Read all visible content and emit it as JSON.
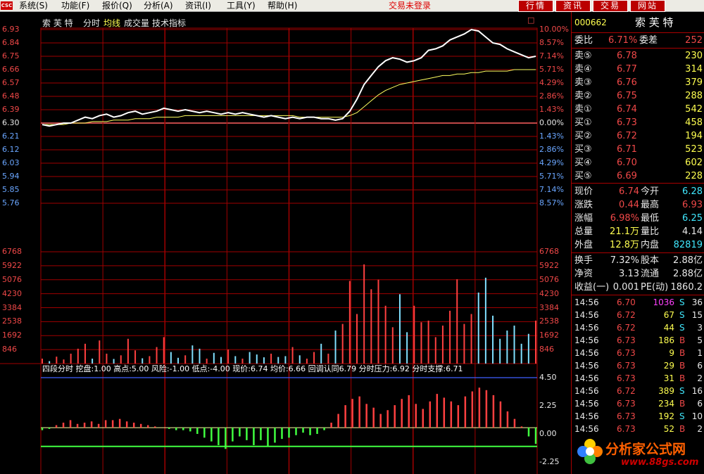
{
  "menubar": {
    "logo": "CSC",
    "menus": [
      "系统(S)",
      "功能(F)",
      "报价(Q)",
      "分析(A)",
      "资讯(I)",
      "工具(Y)",
      "帮助(H)"
    ],
    "login_status": "交易未登录",
    "buttons": [
      "行情",
      "资讯",
      "交易",
      "网站"
    ]
  },
  "chart": {
    "stock_name": "索 芙 特",
    "tabs": [
      "分时",
      "均线",
      "成交量",
      "技术指标"
    ],
    "price_ticks": [
      "6.93",
      "6.84",
      "6.75",
      "6.66",
      "6.57",
      "6.48",
      "6.39",
      "6.30",
      "6.21",
      "6.12",
      "6.03",
      "5.94",
      "5.85",
      "5.76"
    ],
    "pct_ticks": [
      "10.00%",
      "8.57%",
      "7.14%",
      "5.71%",
      "4.29%",
      "2.86%",
      "1.43%",
      "0.00%",
      "1.43%",
      "2.86%",
      "4.29%",
      "5.71%",
      "7.14%",
      "8.57%"
    ],
    "volume_ticks": [
      "6768",
      "5922",
      "5076",
      "4230",
      "3384",
      "2538",
      "1692",
      "846"
    ],
    "indicator_header": [
      "四段分时",
      "挖盘:1.00",
      "高点:5.00",
      "风险:-1.00",
      "低点:-4.00",
      "现价:6.74",
      "均价:6.66",
      "回调认同6.79",
      "分时压力:6.92",
      "分时支撑:6.71"
    ],
    "indicator_ticks": [
      "4.50",
      "2.25",
      "0.00",
      "-2.25"
    ],
    "corner_box": "□",
    "colors": {
      "up": "#f04848",
      "down": "#40ff40",
      "price_line": "#ffffff",
      "avg_line": "#ffff60",
      "grid": "#a00000",
      "axis_blue": "#6aa6ff"
    }
  },
  "chart_data": {
    "type": "line",
    "x_label": "",
    "price_series": [
      6.29,
      6.28,
      6.29,
      6.3,
      6.3,
      6.32,
      6.34,
      6.33,
      6.35,
      6.36,
      6.34,
      6.35,
      6.37,
      6.38,
      6.36,
      6.37,
      6.38,
      6.4,
      6.39,
      6.38,
      6.39,
      6.38,
      6.37,
      6.38,
      6.37,
      6.36,
      6.37,
      6.36,
      6.37,
      6.36,
      6.35,
      6.34,
      6.35,
      6.34,
      6.33,
      6.34,
      6.33,
      6.34,
      6.34,
      6.33,
      6.33,
      6.32,
      6.33,
      6.38,
      6.46,
      6.56,
      6.62,
      6.68,
      6.72,
      6.74,
      6.73,
      6.71,
      6.72,
      6.74,
      6.79,
      6.8,
      6.82,
      6.86,
      6.88,
      6.9,
      6.93,
      6.92,
      6.88,
      6.84,
      6.83,
      6.8,
      6.78,
      6.76,
      6.74,
      6.75
    ],
    "avg_series": [
      6.29,
      6.29,
      6.29,
      6.29,
      6.3,
      6.3,
      6.3,
      6.31,
      6.31,
      6.31,
      6.32,
      6.32,
      6.32,
      6.33,
      6.33,
      6.33,
      6.34,
      6.34,
      6.34,
      6.34,
      6.35,
      6.35,
      6.35,
      6.35,
      6.35,
      6.35,
      6.35,
      6.35,
      6.35,
      6.35,
      6.35,
      6.35,
      6.35,
      6.35,
      6.35,
      6.35,
      6.34,
      6.34,
      6.34,
      6.34,
      6.34,
      6.34,
      6.34,
      6.35,
      6.37,
      6.41,
      6.45,
      6.49,
      6.52,
      6.54,
      6.56,
      6.57,
      6.58,
      6.59,
      6.6,
      6.61,
      6.62,
      6.62,
      6.63,
      6.63,
      6.64,
      6.64,
      6.65,
      6.65,
      6.65,
      6.65,
      6.66,
      6.66,
      6.66,
      6.66
    ],
    "volume_series": [
      300,
      150,
      420,
      250,
      600,
      900,
      1200,
      300,
      1400,
      600,
      280,
      500,
      1500,
      800,
      320,
      450,
      1000,
      1600,
      700,
      350,
      500,
      1100,
      900,
      300,
      650,
      400,
      850,
      450,
      300,
      700,
      550,
      380,
      600,
      400,
      450,
      1000,
      500,
      300,
      700,
      1200,
      600,
      2000,
      2400,
      5000,
      3000,
      6000,
      4500,
      5076,
      3500,
      2200,
      4200,
      1900,
      3500,
      2500,
      2600,
      1600,
      2300,
      3200,
      5100,
      2400,
      3000,
      4300,
      5200,
      2900,
      1500,
      2000,
      2300,
      1200,
      1800,
      2600
    ],
    "indicator_series": [
      0.3,
      0.4,
      0.7,
      0.9,
      1.1,
      0.8,
      0.9,
      1.0,
      0.8,
      1.1,
      1.1,
      1.2,
      1.0,
      0.9,
      0.8,
      0.7,
      0.6,
      0.5,
      0.4,
      0.3,
      0.3,
      0.2,
      0.0,
      -0.3,
      -0.6,
      -0.9,
      -1.2,
      -0.6,
      -0.2,
      -0.5,
      -0.9,
      -0.5,
      -1.0,
      -0.7,
      -0.4,
      -0.3,
      -0.1,
      0.1,
      -0.1,
      0.0,
      0.3,
      0.9,
      1.6,
      2.3,
      2.8,
      3.0,
      2.4,
      2.1,
      1.6,
      1.9,
      2.3,
      2.8,
      3.1,
      2.4,
      2.0,
      2.6,
      3.2,
      2.9,
      2.6,
      2.3,
      3.0,
      3.4,
      3.7,
      3.5,
      3.1,
      2.6,
      1.8,
      1.2,
      0.6,
      -0.2,
      -0.8
    ],
    "price_range": [
      5.76,
      6.93
    ],
    "prev_close": 6.3,
    "volume_range": [
      0,
      6768
    ],
    "indicator_range": [
      -2.25,
      4.5
    ]
  },
  "panel": {
    "code": "000662",
    "name": "索 芙 特",
    "webi_label": "委比",
    "webi_value": "6.71%",
    "weicha_label": "委差",
    "weicha_value": "252",
    "sells": [
      {
        "label": "卖⑤",
        "price": "6.78",
        "vol": "230"
      },
      {
        "label": "卖④",
        "price": "6.77",
        "vol": "314"
      },
      {
        "label": "卖③",
        "price": "6.76",
        "vol": "379"
      },
      {
        "label": "卖②",
        "price": "6.75",
        "vol": "288"
      },
      {
        "label": "卖①",
        "price": "6.74",
        "vol": "542"
      }
    ],
    "buys": [
      {
        "label": "买①",
        "price": "6.73",
        "vol": "458"
      },
      {
        "label": "买②",
        "price": "6.72",
        "vol": "194"
      },
      {
        "label": "买③",
        "price": "6.71",
        "vol": "523"
      },
      {
        "label": "买④",
        "price": "6.70",
        "vol": "602"
      },
      {
        "label": "买⑤",
        "price": "6.69",
        "vol": "228"
      }
    ],
    "quote": [
      {
        "l1": "现价",
        "v1": "6.74",
        "l2": "今开",
        "v2": "6.28"
      },
      {
        "l1": "涨跌",
        "v1": "0.44",
        "l2": "最高",
        "v2": "6.93"
      },
      {
        "l1": "涨幅",
        "v1": "6.98%",
        "l2": "最低",
        "v2": "6.25"
      },
      {
        "l1": "总量",
        "v1": "21.1万",
        "l2": "量比",
        "v2": "4.14"
      },
      {
        "l1": "外盘",
        "v1": "12.8万",
        "l2": "内盘",
        "v2": "82819"
      }
    ],
    "finance": [
      {
        "l1": "换手",
        "v1": "7.32%",
        "l2": "股本",
        "v2": "2.88亿"
      },
      {
        "l1": "净资",
        "v1": "3.13",
        "l2": "流通",
        "v2": "2.88亿"
      },
      {
        "l1": "收益(一)",
        "v1": "0.001",
        "l2": "PE(动)",
        "v2": "1860.2"
      }
    ],
    "ticks": [
      {
        "time": "14:56",
        "price": "6.70",
        "vol": "1036",
        "bs": "S",
        "n": "36"
      },
      {
        "time": "14:56",
        "price": "6.72",
        "vol": "67",
        "bs": "S",
        "n": "15"
      },
      {
        "time": "14:56",
        "price": "6.72",
        "vol": "44",
        "bs": "S",
        "n": "3"
      },
      {
        "time": "14:56",
        "price": "6.73",
        "vol": "186",
        "bs": "B",
        "n": "5"
      },
      {
        "time": "14:56",
        "price": "6.73",
        "vol": "9",
        "bs": "B",
        "n": "1"
      },
      {
        "time": "14:56",
        "price": "6.73",
        "vol": "29",
        "bs": "B",
        "n": "6"
      },
      {
        "time": "14:56",
        "price": "6.73",
        "vol": "31",
        "bs": "B",
        "n": "2"
      },
      {
        "time": "14:56",
        "price": "6.72",
        "vol": "389",
        "bs": "S",
        "n": "16"
      },
      {
        "time": "14:56",
        "price": "6.73",
        "vol": "234",
        "bs": "B",
        "n": "6"
      },
      {
        "time": "14:56",
        "price": "6.73",
        "vol": "192",
        "bs": "S",
        "n": "10"
      },
      {
        "time": "14:56",
        "price": "6.73",
        "vol": "52",
        "bs": "B",
        "n": "2"
      }
    ]
  },
  "watermark": {
    "title": "分析家公式网",
    "url": "www.88gs.com"
  }
}
